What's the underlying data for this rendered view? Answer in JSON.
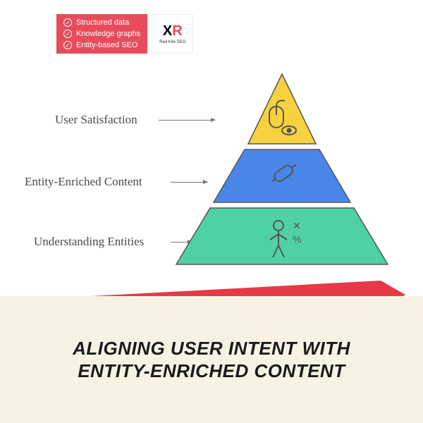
{
  "header": {
    "badges": [
      "Structured data",
      "Knowledge graphs",
      "Entity-based SEO"
    ],
    "logo_text": "Red Kite SEO"
  },
  "pyramid": {
    "layers": [
      {
        "label": "User Satisfaction",
        "color": "#f7d23e",
        "icon": "mouse-eye"
      },
      {
        "label": "Entity-Enriched Content",
        "color": "#4a86e8",
        "icon": "pen"
      },
      {
        "label": "Understanding Entities",
        "color": "#4fd1a5",
        "icon": "person-data"
      }
    ]
  },
  "title": "ALIGNING USER INTENT WITH ENTITY-ENRICHED CONTENT",
  "colors": {
    "accent": "#e74c5b",
    "cream": "#f7f2e4"
  }
}
